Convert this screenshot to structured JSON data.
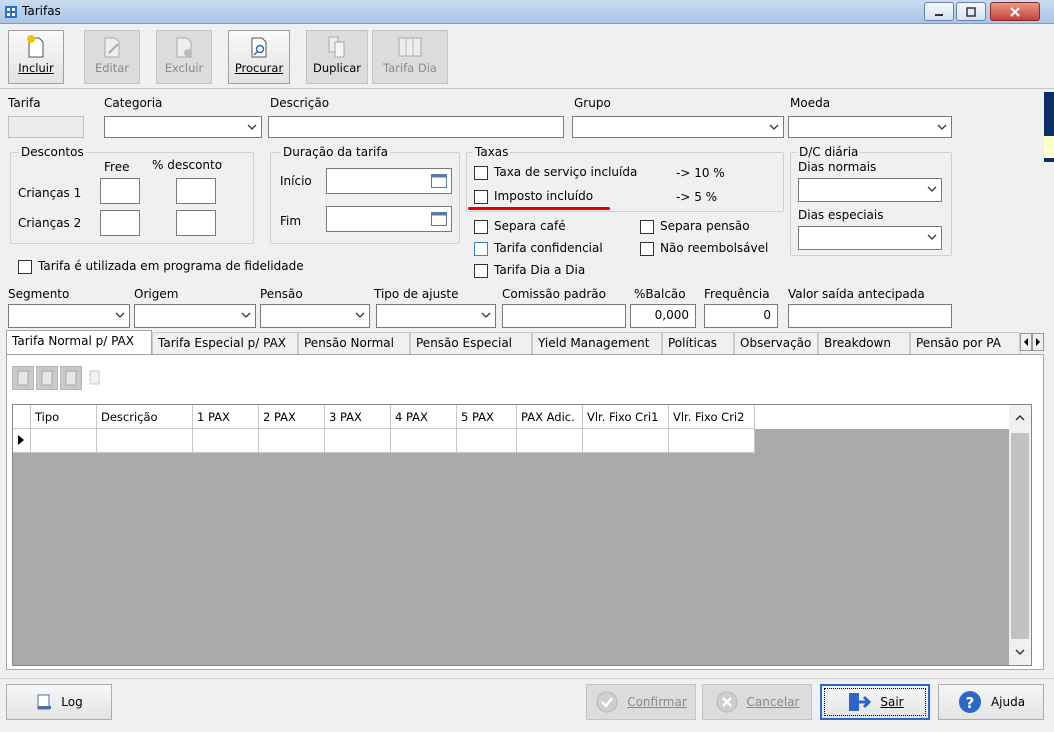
{
  "window": {
    "title": "Tarifas"
  },
  "toolbar": {
    "incluir": "Incluir",
    "editar": "Editar",
    "excluir": "Excluir",
    "procurar": "Procurar",
    "duplicar": "Duplicar",
    "tarifa_dia": "Tarifa Dia"
  },
  "form": {
    "tarifa_label": "Tarifa",
    "categoria_label": "Categoria",
    "descricao_label": "Descrição",
    "grupo_label": "Grupo",
    "moeda_label": "Moeda",
    "descontos_title": "Descontos",
    "free_label": "Free",
    "pct_desconto_label": "% desconto",
    "criancas1_label": "Crianças 1",
    "criancas2_label": "Crianças 2",
    "duracao_title": "Duração da tarifa",
    "inicio_label": "Início",
    "fim_label": "Fim",
    "taxas_title": "Taxas",
    "taxa_servico_label": "Taxa de serviço incluída",
    "taxa_servico_value": "-> 10 %",
    "imposto_label": "Imposto incluído",
    "imposto_value": "-> 5  %",
    "separa_cafe": "Separa café",
    "separa_pensao": "Separa pensão",
    "tarifa_confidencial": "Tarifa confidencial",
    "nao_reembolsavel": "Não reembolsável",
    "tarifa_dia_a_dia": "Tarifa Dia a Dia",
    "dc_title": "D/C diária",
    "dias_normais": "Dias normais",
    "dias_especiais": "Dias especiais",
    "fidelidade_label": "Tarifa é utilizada em programa de fidelidade",
    "segmento_label": "Segmento",
    "origem_label": "Origem",
    "pensao_label": "Pensão",
    "tipo_ajuste_label": "Tipo de ajuste",
    "comissao_label": "Comissão padrão",
    "balcao_label": "%Balcão",
    "balcao_value": "0,000",
    "frequencia_label": "Frequência",
    "frequencia_value": "0",
    "valor_saida_label": "Valor saída antecipada"
  },
  "tabs": [
    "Tarifa Normal p/ PAX",
    "Tarifa Especial p/ PAX",
    "Pensão Normal",
    "Pensão Especial",
    "Yield Management",
    "Políticas",
    "Observação",
    "Breakdown",
    "Pensão por PA"
  ],
  "grid": {
    "columns": [
      "Tipo",
      "Descrição",
      "1 PAX",
      "2 PAX",
      "3 PAX",
      "4 PAX",
      "5 PAX",
      "PAX Adic.",
      "Vlr. Fixo Cri1",
      "Vlr. Fixo Cri2"
    ]
  },
  "bottom": {
    "log": "Log",
    "confirmar": "Confirmar",
    "cancelar": "Cancelar",
    "sair": "Sair",
    "ajuda": "Ajuda"
  },
  "colors": {
    "accent": "#2b66c8",
    "highlight_underline": "#e00000"
  }
}
